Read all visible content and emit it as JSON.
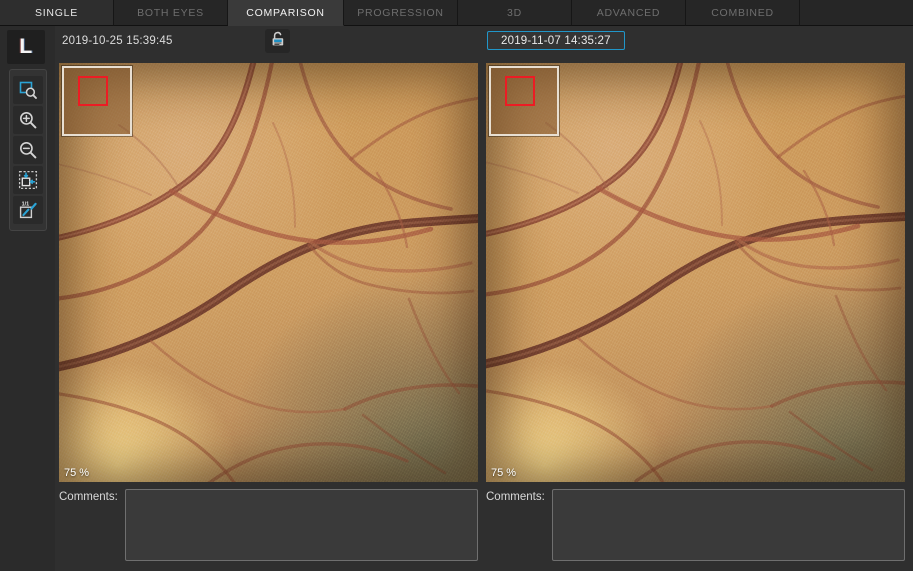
{
  "tabs": [
    {
      "label": "SINGLE",
      "state": "semi"
    },
    {
      "label": "BOTH EYES",
      "state": "inactive"
    },
    {
      "label": "COMPARISON",
      "state": "selected"
    },
    {
      "label": "PROGRESSION",
      "state": "inactive"
    },
    {
      "label": "3D",
      "state": "inactive"
    },
    {
      "label": "ADVANCED",
      "state": "inactive"
    },
    {
      "label": "COMBINED",
      "state": "inactive"
    }
  ],
  "eye_indicator": {
    "label": "L",
    "meaning": "Left eye"
  },
  "toolbar": {
    "tools": [
      {
        "name": "zoom-region-icon",
        "tooltip": "Zoom to region"
      },
      {
        "name": "zoom-in-icon",
        "tooltip": "Zoom in"
      },
      {
        "name": "zoom-out-icon",
        "tooltip": "Zoom out"
      },
      {
        "name": "fit-to-window-icon",
        "tooltip": "Fit to window"
      },
      {
        "name": "actual-size-icon",
        "tooltip": "Actual size 1:1"
      }
    ]
  },
  "header": {
    "left_date": "2019-10-25 15:39:45",
    "right_date": "2019-11-07 14:35:27",
    "sync_button": {
      "name": "sync-lock-icon",
      "state": "unlocked"
    }
  },
  "panes": {
    "left": {
      "zoom_label": "75 %",
      "navigator": {
        "visible": true,
        "viewport_color": "#ec1c24"
      },
      "comments_label": "Comments:",
      "comments_value": "",
      "comments_placeholder": ""
    },
    "right": {
      "zoom_label": "75 %",
      "navigator": {
        "visible": true,
        "viewport_color": "#ec1c24"
      },
      "comments_label": "Comments:",
      "comments_value": "",
      "comments_placeholder": ""
    }
  },
  "colors": {
    "accent": "#2196c9",
    "viewport_marker": "#ec1c24",
    "tab_selected_bg": "#3a3a3a",
    "app_bg": "#2f2f2f",
    "tabbar_bg": "#1d1d1d"
  }
}
